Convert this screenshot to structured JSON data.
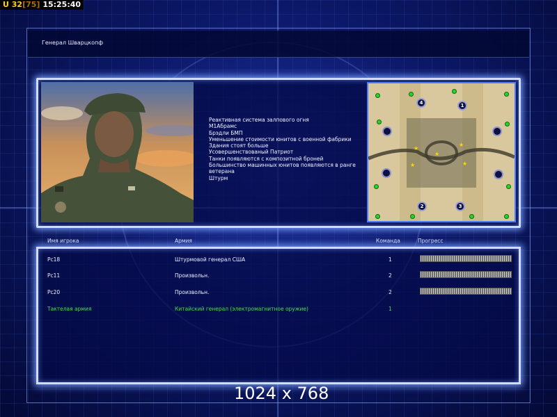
{
  "hud": {
    "units_label": "U",
    "units": "32",
    "limit": "[75]",
    "clock": "15:25:40"
  },
  "general": {
    "title": "Генерал Шварцкопф",
    "abilities": [
      "Реактивная система залпового огня",
      "M1Абрамс",
      "Брэдли БМП",
      "Уменьшение стоимости юнитов с военной фабрики",
      "Здания стоят больше",
      "Усовершенствованый Патриот",
      "Танки появляются с композитной броней",
      "Большинство машинных юнитов появляются в ранге ветерана",
      "Штурм"
    ]
  },
  "map": {
    "start_positions": [
      "4",
      "1",
      "2",
      "3"
    ]
  },
  "players_table": {
    "headers": {
      "name": "Имя игрока",
      "army": "Армия",
      "team": "Команда",
      "progress": "Прогресс"
    },
    "rows": [
      {
        "name": "Pc18",
        "army": "Штурмовой генерал США",
        "team": "1",
        "is_ai": false
      },
      {
        "name": "Pc11",
        "army": "Произвольн.",
        "team": "2",
        "is_ai": false
      },
      {
        "name": "Pc20",
        "army": "Произвольн.",
        "team": "2",
        "is_ai": false
      },
      {
        "name": "Тактелая армия",
        "army": "Китайский генерал (электромагнитное оружие)",
        "team": "1",
        "is_ai": true
      }
    ]
  },
  "overlay": {
    "resolution": "1024 x 768"
  },
  "colors": {
    "ai_text": "#3fe04a",
    "panel_glow": "#d0dcff",
    "background": "#050a3a"
  }
}
